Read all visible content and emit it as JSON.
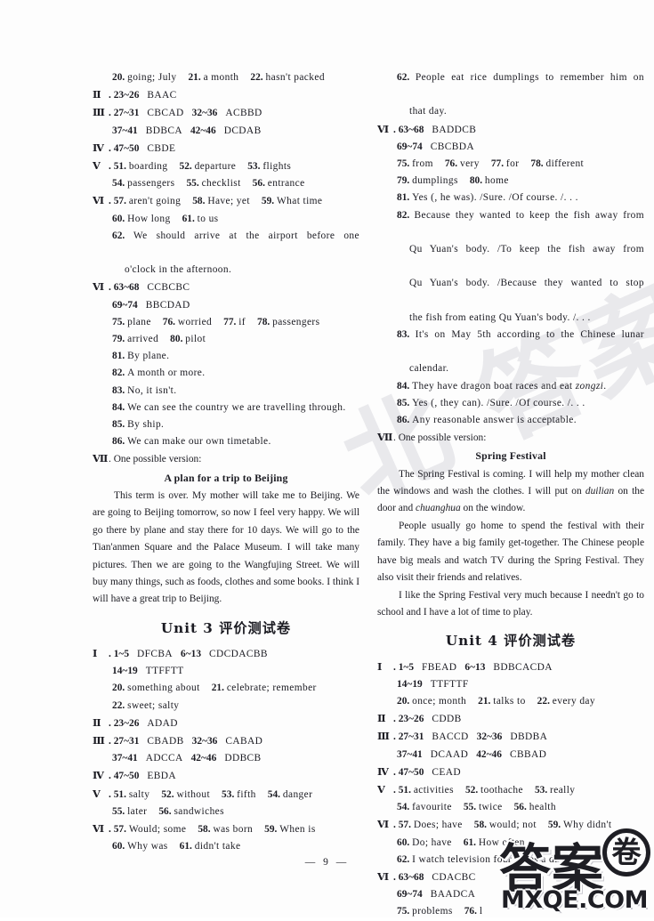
{
  "page": {
    "number": "9",
    "footer_text": "— 9 —",
    "watermark_diagonal": "北 答案",
    "logo": {
      "cjk": "答案",
      "circled_char": "卷",
      "domain": "MXQE.COM"
    }
  },
  "left_column": [
    {
      "type": "items",
      "indent": "ind1",
      "items": [
        {
          "n": "20.",
          "a": "going; July"
        },
        {
          "n": "21.",
          "a": "a month"
        },
        {
          "n": "22.",
          "a": "hasn't packed"
        }
      ]
    },
    {
      "type": "roman",
      "rom": "Ⅱ",
      "groups": [
        {
          "range": "23~26",
          "ans": "BAAC"
        }
      ]
    },
    {
      "type": "roman",
      "rom": "Ⅲ",
      "groups": [
        {
          "range": "27~31",
          "ans": "CBCAD"
        },
        {
          "range": "32~36",
          "ans": "ACBBD"
        }
      ]
    },
    {
      "type": "ranges",
      "indent": "ind1",
      "groups": [
        {
          "range": "37~41",
          "ans": "BDBCA"
        },
        {
          "range": "42~46",
          "ans": "DCDAB"
        }
      ]
    },
    {
      "type": "roman",
      "rom": "Ⅳ",
      "groups": [
        {
          "range": "47~50",
          "ans": "CBDE"
        }
      ]
    },
    {
      "type": "roman_items",
      "rom": "Ⅴ",
      "items": [
        {
          "n": "51.",
          "a": "boarding"
        },
        {
          "n": "52.",
          "a": "departure"
        },
        {
          "n": "53.",
          "a": "flights"
        }
      ]
    },
    {
      "type": "items",
      "indent": "ind1",
      "items": [
        {
          "n": "54.",
          "a": "passengers"
        },
        {
          "n": "55.",
          "a": "checklist"
        },
        {
          "n": "56.",
          "a": "entrance"
        }
      ]
    },
    {
      "type": "roman_items",
      "rom": "Ⅵ",
      "items": [
        {
          "n": "57.",
          "a": "aren't going"
        },
        {
          "n": "58.",
          "a": "Have; yet"
        },
        {
          "n": "59.",
          "a": "What time"
        }
      ]
    },
    {
      "type": "items",
      "indent": "ind1",
      "items": [
        {
          "n": "60.",
          "a": "How long"
        },
        {
          "n": "61.",
          "a": "to us"
        }
      ]
    },
    {
      "type": "sentence_just",
      "n": "62.",
      "text": "We should arrive at the airport before one",
      "cont": "o'clock in the afternoon."
    },
    {
      "type": "roman",
      "rom": "Ⅵ",
      "groups": [
        {
          "range": "63~68",
          "ans": "CCBCBC"
        }
      ]
    },
    {
      "type": "ranges",
      "indent": "ind1",
      "groups": [
        {
          "range": "69~74",
          "ans": "BBCDAD"
        }
      ]
    },
    {
      "type": "items",
      "indent": "ind1",
      "items": [
        {
          "n": "75.",
          "a": "plane"
        },
        {
          "n": "76.",
          "a": "worried"
        },
        {
          "n": "77.",
          "a": "if"
        },
        {
          "n": "78.",
          "a": "passengers"
        }
      ]
    },
    {
      "type": "items",
      "indent": "ind1",
      "items": [
        {
          "n": "79.",
          "a": "arrived"
        },
        {
          "n": "80.",
          "a": "pilot"
        }
      ]
    },
    {
      "type": "sentence",
      "indent": "ind1",
      "n": "81.",
      "text": "By plane."
    },
    {
      "type": "sentence",
      "indent": "ind1",
      "n": "82.",
      "text": "A month or more."
    },
    {
      "type": "sentence",
      "indent": "ind1",
      "n": "83.",
      "text": "No, it isn't."
    },
    {
      "type": "sentence",
      "indent": "ind1",
      "n": "84.",
      "text": "We can see the country we are travelling through."
    },
    {
      "type": "sentence",
      "indent": "ind1",
      "n": "85.",
      "text": "By ship."
    },
    {
      "type": "sentence",
      "indent": "ind1",
      "n": "86.",
      "text": "We can make our own timetable."
    },
    {
      "type": "roman_text",
      "rom": "Ⅶ",
      "text": ". One possible version:"
    },
    {
      "type": "comp_title",
      "text": "A plan for a trip to Beijing"
    },
    {
      "type": "para",
      "text": "This term is over. My mother will take me to Beijing. We are going to Beijing tomorrow, so now I feel very happy. We will go there by plane and stay there for 10 days. We will go to the Tian'anmen Square and the Palace Museum. I will take many pictures. Then we are going to the Wangfujing Street. We will buy many things, such as foods, clothes and some books. I think I will have a great trip to Beijing."
    },
    {
      "type": "unit_head",
      "text": "Unit 3 评价测试卷"
    },
    {
      "type": "roman",
      "rom": "Ⅰ",
      "groups": [
        {
          "range": "1~5",
          "ans": "DFCBA"
        },
        {
          "range": "6~13",
          "ans": "CDCDACBB"
        }
      ]
    },
    {
      "type": "ranges",
      "indent": "ind1",
      "groups": [
        {
          "range": "14~19",
          "ans": "TTFFTT"
        }
      ]
    },
    {
      "type": "items",
      "indent": "ind1",
      "items": [
        {
          "n": "20.",
          "a": "something about"
        },
        {
          "n": "21.",
          "a": "celebrate; remember"
        }
      ]
    },
    {
      "type": "items",
      "indent": "ind1",
      "items": [
        {
          "n": "22.",
          "a": "sweet; salty"
        }
      ]
    },
    {
      "type": "roman",
      "rom": "Ⅱ",
      "groups": [
        {
          "range": "23~26",
          "ans": "ADAD"
        }
      ]
    },
    {
      "type": "roman",
      "rom": "Ⅲ",
      "groups": [
        {
          "range": "27~31",
          "ans": "CBADB"
        },
        {
          "range": "32~36",
          "ans": "CABAD"
        }
      ]
    },
    {
      "type": "ranges",
      "indent": "ind1",
      "groups": [
        {
          "range": "37~41",
          "ans": "ADCCA"
        },
        {
          "range": "42~46",
          "ans": "DDBCB"
        }
      ]
    },
    {
      "type": "roman",
      "rom": "Ⅳ",
      "groups": [
        {
          "range": "47~50",
          "ans": "EBDA"
        }
      ]
    },
    {
      "type": "roman_items",
      "rom": "Ⅴ",
      "items": [
        {
          "n": "51.",
          "a": "salty"
        },
        {
          "n": "52.",
          "a": "without"
        },
        {
          "n": "53.",
          "a": "fifth"
        },
        {
          "n": "54.",
          "a": "danger"
        }
      ]
    },
    {
      "type": "items",
      "indent": "ind1",
      "items": [
        {
          "n": "55.",
          "a": "later"
        },
        {
          "n": "56.",
          "a": "sandwiches"
        }
      ]
    },
    {
      "type": "roman_items",
      "rom": "Ⅵ",
      "items": [
        {
          "n": "57.",
          "a": "Would; some"
        },
        {
          "n": "58.",
          "a": "was born"
        },
        {
          "n": "59.",
          "a": "When is"
        }
      ]
    },
    {
      "type": "items",
      "indent": "ind1",
      "items": [
        {
          "n": "60.",
          "a": "Why was"
        },
        {
          "n": "61.",
          "a": "didn't take"
        }
      ]
    }
  ],
  "right_column": [
    {
      "type": "sentence_just",
      "n": "62.",
      "text": "People eat rice dumplings to remember him on",
      "cont": "that day."
    },
    {
      "type": "roman",
      "rom": "Ⅵ",
      "groups": [
        {
          "range": "63~68",
          "ans": "BADDCB"
        }
      ]
    },
    {
      "type": "ranges",
      "indent": "ind1",
      "groups": [
        {
          "range": "69~74",
          "ans": "CBCBDA"
        }
      ]
    },
    {
      "type": "items",
      "indent": "ind1",
      "items": [
        {
          "n": "75.",
          "a": "from"
        },
        {
          "n": "76.",
          "a": "very"
        },
        {
          "n": "77.",
          "a": "for"
        },
        {
          "n": "78.",
          "a": "different"
        }
      ]
    },
    {
      "type": "items",
      "indent": "ind1",
      "items": [
        {
          "n": "79.",
          "a": "dumplings"
        },
        {
          "n": "80.",
          "a": "home"
        }
      ]
    },
    {
      "type": "sentence",
      "indent": "ind1",
      "n": "81.",
      "text": "Yes (, he was). /Sure. /Of course. /. . ."
    },
    {
      "type": "sentence_just4",
      "n": "82.",
      "lines": [
        "Because they wanted to keep the fish away from",
        "Qu Yuan's body. /To keep the fish away from",
        "Qu Yuan's body. /Because they wanted to stop",
        "the fish from eating Qu Yuan's body. /. . ."
      ]
    },
    {
      "type": "sentence_just",
      "n": "83.",
      "text": "It's on May 5th according to the Chinese lunar",
      "cont": "calendar."
    },
    {
      "type": "sentence_italic",
      "indent": "ind1",
      "n": "84.",
      "pre": "They have dragon boat races and eat ",
      "italic": "zongzi",
      "post": "."
    },
    {
      "type": "sentence",
      "indent": "ind1",
      "n": "85.",
      "text": "Yes (, they can). /Sure. /Of course. /. . ."
    },
    {
      "type": "sentence",
      "indent": "ind1",
      "n": "86.",
      "text": "Any reasonable answer is acceptable."
    },
    {
      "type": "roman_text",
      "rom": "Ⅶ",
      "text": ". One possible version:"
    },
    {
      "type": "comp_title",
      "text": "Spring Festival"
    },
    {
      "type": "para_italic",
      "segments": [
        {
          "t": "The Spring Festival is coming. I will help my mother clean the windows and wash the clothes. I will put on "
        },
        {
          "t": "duilian",
          "i": true
        },
        {
          "t": " on the door and "
        },
        {
          "t": "chuanghua",
          "i": true
        },
        {
          "t": " on the window."
        }
      ]
    },
    {
      "type": "para",
      "text": "People usually go home to spend the festival with their family. They have a big family get-together. The Chinese people have big meals and watch TV during the Spring Festival. They also visit their friends and relatives."
    },
    {
      "type": "para",
      "text": "I like the Spring Festival very much because I needn't go to school and I have a lot of time to play."
    },
    {
      "type": "unit_head",
      "text": "Unit 4 评价测试卷"
    },
    {
      "type": "roman",
      "rom": "Ⅰ",
      "groups": [
        {
          "range": "1~5",
          "ans": "FBEAD"
        },
        {
          "range": "6~13",
          "ans": "BDBCACDA"
        }
      ]
    },
    {
      "type": "ranges",
      "indent": "ind1",
      "groups": [
        {
          "range": "14~19",
          "ans": "TTFTTF"
        }
      ]
    },
    {
      "type": "items",
      "indent": "ind1",
      "items": [
        {
          "n": "20.",
          "a": "once; month"
        },
        {
          "n": "21.",
          "a": "talks to"
        },
        {
          "n": "22.",
          "a": "every day"
        }
      ]
    },
    {
      "type": "roman",
      "rom": "Ⅱ",
      "groups": [
        {
          "range": "23~26",
          "ans": "CDDB"
        }
      ]
    },
    {
      "type": "roman",
      "rom": "Ⅲ",
      "groups": [
        {
          "range": "27~31",
          "ans": "BACCD"
        },
        {
          "range": "32~36",
          "ans": "DBDBA"
        }
      ]
    },
    {
      "type": "ranges",
      "indent": "ind1",
      "groups": [
        {
          "range": "37~41",
          "ans": "DCAAD"
        },
        {
          "range": "42~46",
          "ans": "CBBAD"
        }
      ]
    },
    {
      "type": "roman",
      "rom": "Ⅳ",
      "groups": [
        {
          "range": "47~50",
          "ans": "CEAD"
        }
      ]
    },
    {
      "type": "roman_items",
      "rom": "Ⅴ",
      "items": [
        {
          "n": "51.",
          "a": "activities"
        },
        {
          "n": "52.",
          "a": "toothache"
        },
        {
          "n": "53.",
          "a": "really"
        }
      ]
    },
    {
      "type": "items",
      "indent": "ind1",
      "items": [
        {
          "n": "54.",
          "a": "favourite"
        },
        {
          "n": "55.",
          "a": "twice"
        },
        {
          "n": "56.",
          "a": "health"
        }
      ]
    },
    {
      "type": "roman_items",
      "rom": "Ⅵ",
      "items": [
        {
          "n": "57.",
          "a": "Does; have"
        },
        {
          "n": "58.",
          "a": "would; not"
        },
        {
          "n": "59.",
          "a": "Why didn't"
        }
      ]
    },
    {
      "type": "items",
      "indent": "ind1",
      "items": [
        {
          "n": "60.",
          "a": "Do; have"
        },
        {
          "n": "61.",
          "a": "How often"
        }
      ]
    },
    {
      "type": "sentence",
      "indent": "ind1",
      "n": "62.",
      "text": "I watch television four times a day."
    },
    {
      "type": "roman",
      "rom": "Ⅵ",
      "groups": [
        {
          "range": "63~68",
          "ans": "CDACBC"
        }
      ]
    },
    {
      "type": "ranges",
      "indent": "ind1",
      "groups": [
        {
          "range": "69~74",
          "ans": "BAADCA"
        }
      ]
    },
    {
      "type": "items",
      "indent": "ind1",
      "items": [
        {
          "n": "75.",
          "a": "problems"
        },
        {
          "n": "76.",
          "a": "l"
        }
      ]
    }
  ]
}
